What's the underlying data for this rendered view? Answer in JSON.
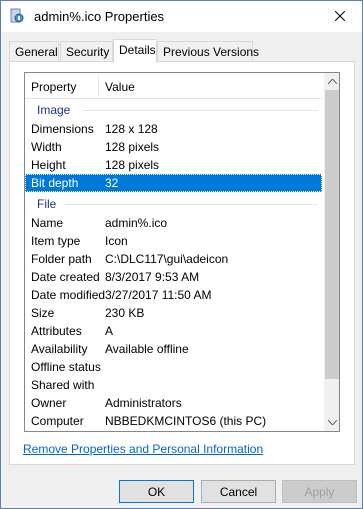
{
  "window": {
    "title": "admin%.ico Properties"
  },
  "tabs": [
    {
      "label": "General"
    },
    {
      "label": "Security"
    },
    {
      "label": "Details",
      "active": true
    },
    {
      "label": "Previous Versions"
    }
  ],
  "list": {
    "header": {
      "property": "Property",
      "value": "Value"
    },
    "image_group": "Image",
    "image_rows": [
      {
        "k": "Dimensions",
        "v": "128 x 128"
      },
      {
        "k": "Width",
        "v": "128 pixels"
      },
      {
        "k": "Height",
        "v": "128 pixels"
      },
      {
        "k": "Bit depth",
        "v": "32"
      }
    ],
    "file_group": "File",
    "file_rows": [
      {
        "k": "Name",
        "v": "admin%.ico"
      },
      {
        "k": "Item type",
        "v": "Icon"
      },
      {
        "k": "Folder path",
        "v": "C:\\DLC117\\gui\\adeicon"
      },
      {
        "k": "Date created",
        "v": "8/3/2017 9:53 AM"
      },
      {
        "k": "Date modified",
        "v": "3/27/2017 11:50 AM"
      },
      {
        "k": "Size",
        "v": "230 KB"
      },
      {
        "k": "Attributes",
        "v": "A"
      },
      {
        "k": "Availability",
        "v": "Available offline"
      },
      {
        "k": "Offline status",
        "v": ""
      },
      {
        "k": "Shared with",
        "v": ""
      },
      {
        "k": "Owner",
        "v": "Administrators"
      },
      {
        "k": "Computer",
        "v": "NBBEDKMCINTOS6 (this PC)"
      }
    ]
  },
  "link": {
    "remove": "Remove Properties and Personal Information"
  },
  "buttons": {
    "ok": "OK",
    "cancel": "Cancel",
    "apply": "Apply"
  },
  "colors": {
    "selection": "#0078d7",
    "group_label": "#1e3287",
    "link": "#0066cc"
  }
}
